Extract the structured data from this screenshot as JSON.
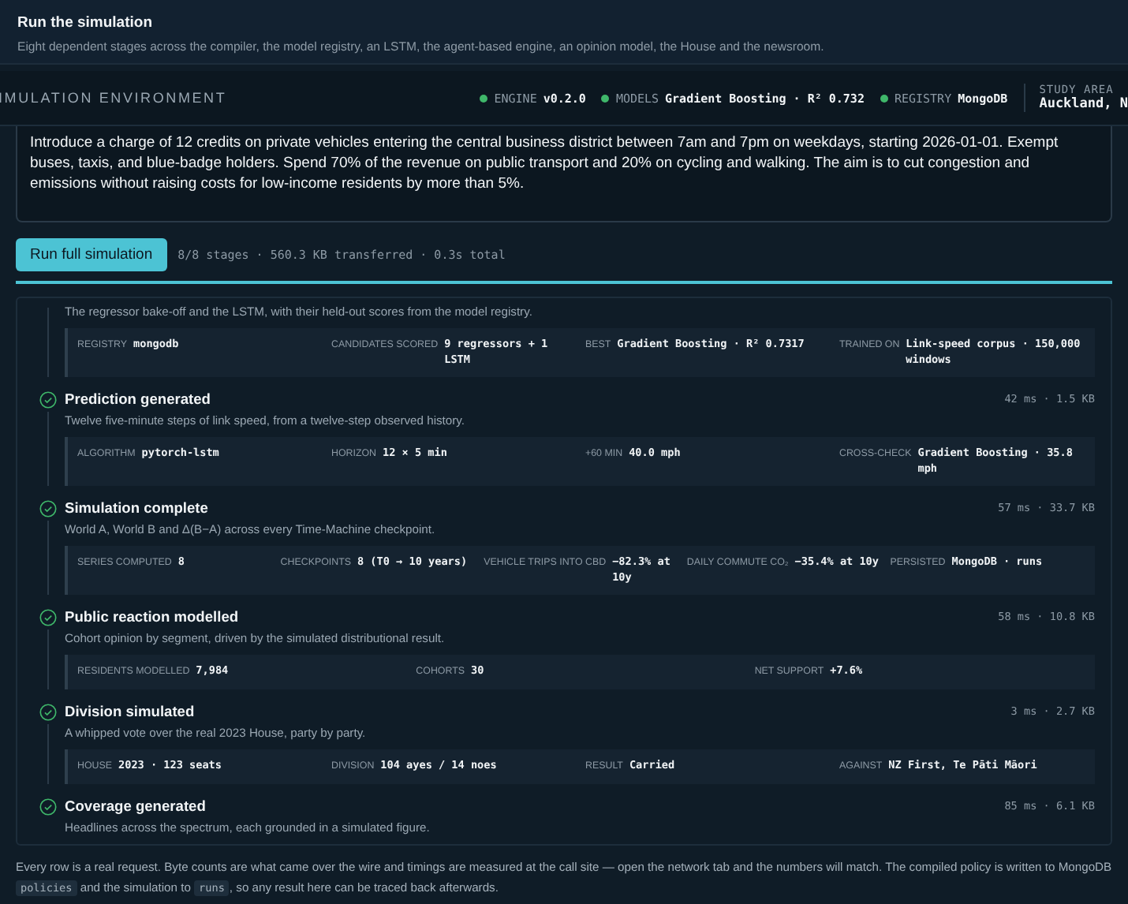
{
  "header": {
    "title": "Run the simulation",
    "subtitle": "Eight dependent stages across the compiler, the model registry, an LSTM, the agent-based engine, an opinion model, the House and the newsroom."
  },
  "environment": {
    "label": "IMULATION ENVIRONMENT",
    "items": [
      {
        "name": "ENGINE",
        "value": "v0.2.0",
        "ok": true
      },
      {
        "name": "MODELS",
        "value": "Gradient Boosting · R² 0.732",
        "ok": true
      },
      {
        "name": "REGISTRY",
        "value": "MongoDB",
        "ok": true
      }
    ],
    "study_area": {
      "label": "STUDY AREA",
      "value": "Auckland, N"
    }
  },
  "policy": {
    "value": "Introduce a charge of 12 credits on private vehicles entering the central business district between 7am and 7pm on weekdays, starting 2026-01-01. Exempt buses, taxis, and blue-badge holders. Spend 70% of the revenue on public transport and 20% on cycling and walking. The aim is to cut congestion and emissions without raising costs for low-income residents by more than 5%."
  },
  "run": {
    "button": "Run full simulation",
    "summary": "8/8 stages · 560.3 KB transferred · 0.3s total"
  },
  "stages": [
    {
      "description": "The regressor bake-off and the LSTM, with their held-out scores from the model registry.",
      "fields": [
        {
          "label": "REGISTRY",
          "value": "mongodb"
        },
        {
          "label": "CANDIDATES SCORED",
          "value": "9 regressors + 1 LSTM"
        },
        {
          "label": "BEST",
          "value": "Gradient Boosting · R² 0.7317"
        },
        {
          "label": "TRAINED ON",
          "value": "Link-speed corpus · 150,000 windows"
        }
      ]
    },
    {
      "complete": true,
      "title": "Prediction generated",
      "meta": "42 ms · 1.5 KB",
      "description": "Twelve five-minute steps of link speed, from a twelve-step observed history.",
      "fields": [
        {
          "label": "ALGORITHM",
          "value": "pytorch-lstm"
        },
        {
          "label": "HORIZON",
          "value": "12 × 5 min"
        },
        {
          "label": "+60 MIN",
          "value": "40.0 mph"
        },
        {
          "label": "CROSS-CHECK",
          "value": "Gradient Boosting · 35.8 mph"
        }
      ]
    },
    {
      "complete": true,
      "title": "Simulation complete",
      "meta": "57 ms · 33.7 KB",
      "description": "World A, World B and Δ(B−A) across every Time-Machine checkpoint.",
      "fields": [
        {
          "label": "SERIES COMPUTED",
          "value": "8"
        },
        {
          "label": "CHECKPOINTS",
          "value": "8 (T0 → 10 years)"
        },
        {
          "label": "VEHICLE TRIPS INTO CBD",
          "value": "−82.3% at 10y"
        },
        {
          "label": "DAILY COMMUTE CO₂",
          "value": "−35.4% at 10y"
        },
        {
          "label": "PERSISTED",
          "value": "MongoDB · runs"
        }
      ]
    },
    {
      "complete": true,
      "title": "Public reaction modelled",
      "meta": "58 ms · 10.8 KB",
      "description": "Cohort opinion by segment, driven by the simulated distributional result.",
      "fields": [
        {
          "label": "RESIDENTS MODELLED",
          "value": "7,984"
        },
        {
          "label": "COHORTS",
          "value": "30"
        },
        {
          "label": "NET SUPPORT",
          "value": "+7.6%"
        }
      ]
    },
    {
      "complete": true,
      "title": "Division simulated",
      "meta": "3 ms · 2.7 KB",
      "description": "A whipped vote over the real 2023 House, party by party.",
      "fields": [
        {
          "label": "HOUSE",
          "value": "2023 · 123 seats"
        },
        {
          "label": "DIVISION",
          "value": "104 ayes / 14 noes"
        },
        {
          "label": "RESULT",
          "value": "Carried"
        },
        {
          "label": "AGAINST",
          "value": "NZ First, Te Pāti Māori"
        }
      ]
    },
    {
      "complete": true,
      "title": "Coverage generated",
      "meta": "85 ms · 6.1 KB",
      "description": "Headlines across the spectrum, each grounded in a simulated figure."
    }
  ],
  "footer": [
    {
      "kind": "text",
      "text": "Every row is a real request. Byte counts are what came over the wire and timings are measured at the call site — open the network tab and the numbers will match. The compiled policy is written to MongoDB "
    },
    {
      "kind": "code",
      "text": "policies"
    },
    {
      "kind": "text",
      "text": " and the simulation to "
    },
    {
      "kind": "code",
      "text": "runs"
    },
    {
      "kind": "text",
      "text": ", so any result here can be traced back afterwards."
    }
  ]
}
